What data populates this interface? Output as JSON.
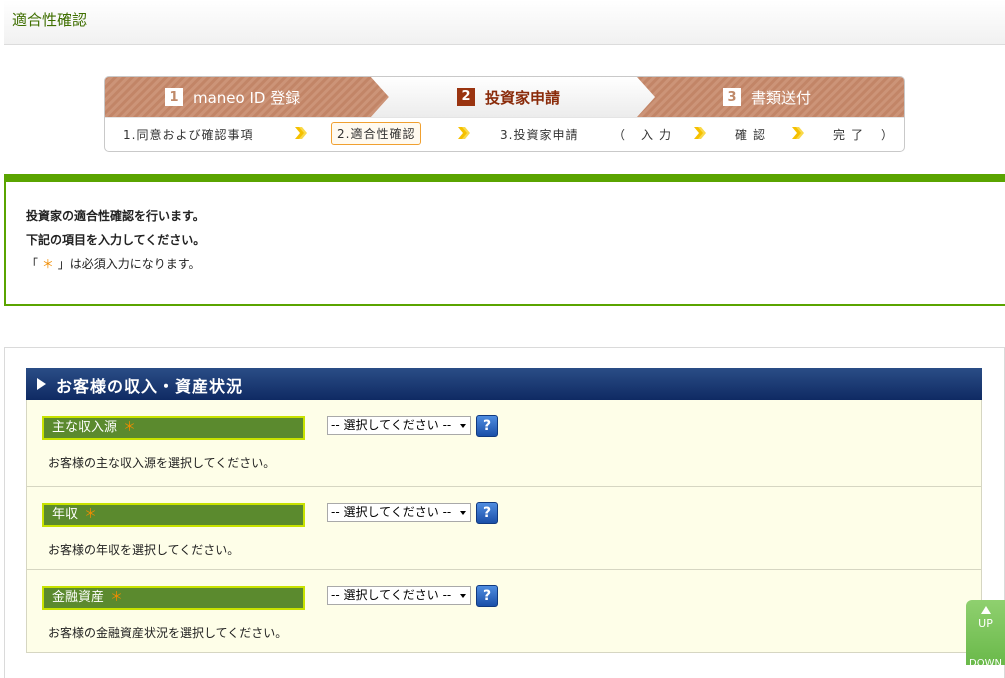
{
  "header": {
    "title": "適合性確認"
  },
  "steps": {
    "major": [
      {
        "num": "1",
        "label": "maneo ID 登録"
      },
      {
        "num": "2",
        "label": "投資家申請"
      },
      {
        "num": "3",
        "label": "書類送付"
      }
    ],
    "sub": {
      "s1": "1.同意および確認事項",
      "s2": "2.適合性確認",
      "s3": "3.投資家申請",
      "open_paren": "（",
      "input": "入力",
      "confirm": "確認",
      "done": "完了",
      "close_paren": "）"
    }
  },
  "info": {
    "line1": "投資家の適合性確認を行います。",
    "line2": "下記の項目を入力してください。",
    "line3_open": "「",
    "line3_mark": "＊",
    "line3_rest": "」は必須入力になります。"
  },
  "form": {
    "section_title": "お客様の収入・資産状況",
    "required_mark": "＊",
    "fields": [
      {
        "label": "主な収入源",
        "select": "-- 選択してください --",
        "help": "?",
        "desc": "お客様の主な収入源を選択してください。"
      },
      {
        "label": "年収",
        "select": "-- 選択してください --",
        "help": "?",
        "desc": "お客様の年収を選択してください。"
      },
      {
        "label": "金融資産",
        "select": "-- 選択してください --",
        "help": "?",
        "desc": "お客様の金融資産状況を選択してください。"
      }
    ]
  },
  "scroll": {
    "up": "UP",
    "down": "DOWN"
  },
  "colors": {
    "brand_green": "#5aa400",
    "step_brown": "#c98f72",
    "navy": "#0f2a63",
    "required": "#f08c00"
  }
}
